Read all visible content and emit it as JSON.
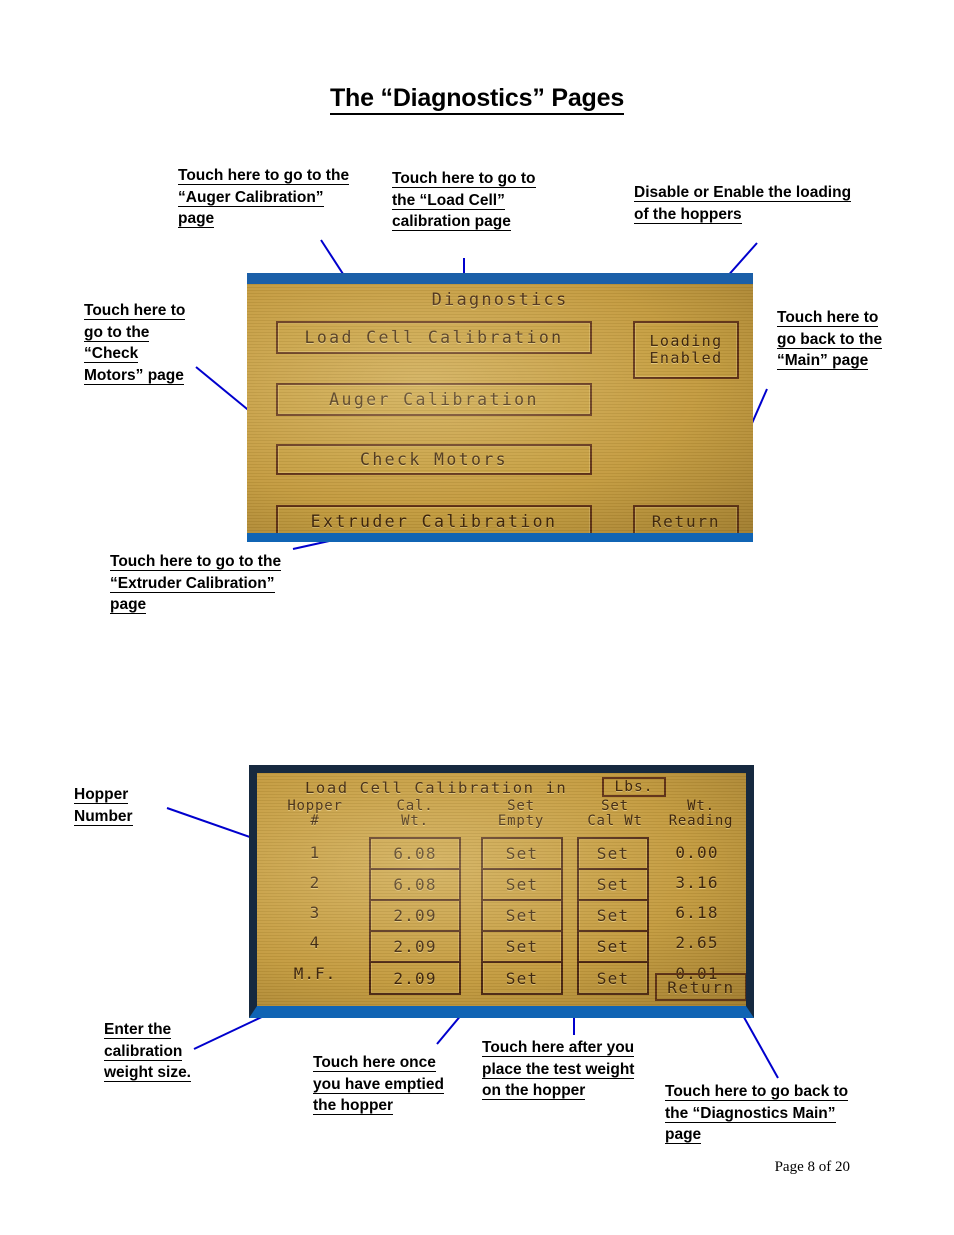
{
  "document": {
    "title": "The “Diagnostics” Pages",
    "footer": "Page 8 of 20"
  },
  "colors": {
    "leader_line": "#0000cd",
    "lcd_background": "#c49b3e",
    "lcd_text": "#3b2209",
    "bezel_blue": "#1064b4",
    "bezel_navy": "#16293f"
  },
  "annotations_top": [
    {
      "id": "auger",
      "text": "Touch here to go to the “Auger Calibration” page"
    },
    {
      "id": "loadcell",
      "text": "Touch here to go to the “Load Cell” calibration page"
    },
    {
      "id": "loading",
      "text": "Disable or Enable the loading of the hoppers"
    },
    {
      "id": "motors",
      "text": "Touch here to go to the “Check Motors” page"
    },
    {
      "id": "main",
      "text": "Touch here to go back to the “Main” page"
    },
    {
      "id": "extruder",
      "text": "Touch here to go to the “Extruder Calibration” page"
    }
  ],
  "annotations_bottom": [
    {
      "id": "hopper-number",
      "text": "Hopper Number"
    },
    {
      "id": "enter-cal-weight",
      "text": "Enter the calibration weight size."
    },
    {
      "id": "set-empty",
      "text": "Touch here once you have emptied the hopper"
    },
    {
      "id": "set-cal-wt",
      "text": "Touch here after you place the test weight on the hopper"
    },
    {
      "id": "return-diag",
      "text": "Touch here to go back to the “Diagnostics Main” page"
    }
  ],
  "screen_diagnostics": {
    "title": "Diagnostics",
    "buttons": {
      "load_cell_calibration": "Load Cell Calibration",
      "auger_calibration": "Auger Calibration",
      "check_motors": "Check Motors",
      "extruder_calibration": "Extruder Calibration",
      "loading_state_line1": "Loading",
      "loading_state_line2": "Enabled",
      "return": "Return"
    }
  },
  "screen_load_cell": {
    "heading": "Load Cell Calibration in",
    "units": "Lbs.",
    "column_headers": {
      "hopper_line1": "Hopper",
      "hopper_line2": "#",
      "cal_wt_line1": "Cal.",
      "cal_wt_line2": "Wt.",
      "set_empty_line1": "Set",
      "set_empty_line2": "Empty",
      "set_cal_wt_line1": "Set",
      "set_cal_wt_line2": "Cal Wt",
      "reading_line1": "Wt.",
      "reading_line2": "Reading"
    },
    "rows": [
      {
        "hopper": "1",
        "cal_wt": "6.08",
        "set_empty": "Set",
        "set_cal_wt": "Set",
        "reading": "0.00"
      },
      {
        "hopper": "2",
        "cal_wt": "6.08",
        "set_empty": "Set",
        "set_cal_wt": "Set",
        "reading": "3.16"
      },
      {
        "hopper": "3",
        "cal_wt": "2.09",
        "set_empty": "Set",
        "set_cal_wt": "Set",
        "reading": "6.18"
      },
      {
        "hopper": "4",
        "cal_wt": "2.09",
        "set_empty": "Set",
        "set_cal_wt": "Set",
        "reading": "2.65"
      },
      {
        "hopper": "M.F.",
        "cal_wt": "2.09",
        "set_empty": "Set",
        "set_cal_wt": "Set",
        "reading": "0.01"
      }
    ],
    "return_button": "Return"
  }
}
